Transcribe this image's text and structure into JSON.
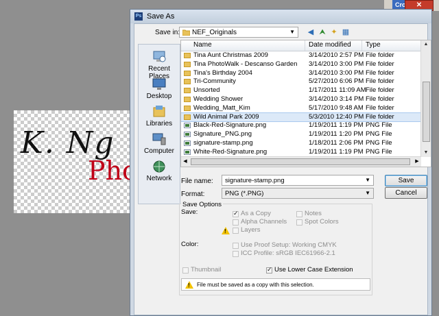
{
  "background": {
    "crop_label": "Crop",
    "close_label": "✕",
    "signature_text": "K. Ng",
    "photo_text": "Pho"
  },
  "dialog": {
    "title": "Save As",
    "save_in_label": "Save in:",
    "save_in_value": "NEF_Originals",
    "places": [
      {
        "label": "Recent Places",
        "icon": "recent-places-icon"
      },
      {
        "label": "Desktop",
        "icon": "desktop-icon"
      },
      {
        "label": "Libraries",
        "icon": "libraries-icon"
      },
      {
        "label": "Computer",
        "icon": "computer-icon"
      },
      {
        "label": "Network",
        "icon": "network-icon"
      }
    ],
    "columns": {
      "name": "Name",
      "date": "Date modified",
      "type": "Type"
    },
    "files": [
      {
        "name": "Tina Aunt Christmas 2009",
        "date": "3/14/2010 2:57 PM",
        "type": "File folder",
        "kind": "folder"
      },
      {
        "name": "Tina PhotoWalk - Descanso Garden",
        "date": "3/14/2010 3:00 PM",
        "type": "File folder",
        "kind": "folder"
      },
      {
        "name": "Tina's Birthday 2004",
        "date": "3/14/2010 3:00 PM",
        "type": "File folder",
        "kind": "folder"
      },
      {
        "name": "Tri-Community",
        "date": "5/27/2010 6:06 PM",
        "type": "File folder",
        "kind": "folder"
      },
      {
        "name": "Unsorted",
        "date": "1/17/2011 11:09 AM",
        "type": "File folder",
        "kind": "folder"
      },
      {
        "name": "Wedding Shower",
        "date": "3/14/2010 3:14 PM",
        "type": "File folder",
        "kind": "folder"
      },
      {
        "name": "Wedding_Matt_Kim",
        "date": "5/17/2010 9:48 AM",
        "type": "File folder",
        "kind": "folder"
      },
      {
        "name": "Wild Animal Park 2009",
        "date": "5/3/2010 12:40 PM",
        "type": "File folder",
        "kind": "folder"
      },
      {
        "name": "Black-Red-Signature.png",
        "date": "1/19/2011 1:19 PM",
        "type": "PNG File",
        "kind": "png"
      },
      {
        "name": "Signature_PNG.png",
        "date": "1/19/2011 1:20 PM",
        "type": "PNG File",
        "kind": "png"
      },
      {
        "name": "signature-stamp.png",
        "date": "1/18/2011 2:06 PM",
        "type": "PNG File",
        "kind": "png"
      },
      {
        "name": "White-Red-Signature.png",
        "date": "1/19/2011 1:19 PM",
        "type": "PNG File",
        "kind": "png"
      }
    ],
    "file_name_label": "File name:",
    "file_name_value": "signature-stamp.png",
    "format_label": "Format:",
    "format_value": "PNG (*.PNG)",
    "save_button": "Save",
    "cancel_button": "Cancel",
    "save_options_title": "Save Options",
    "save_label": "Save:",
    "as_a_copy": "As a Copy",
    "notes": "Notes",
    "alpha_channels": "Alpha Channels",
    "spot_colors": "Spot Colors",
    "layers": "Layers",
    "color_label": "Color:",
    "use_proof_setup": "Use Proof Setup:  Working CMYK",
    "icc_profile": "ICC Profile:  sRGB IEC61966-2.1",
    "thumbnail": "Thumbnail",
    "use_lower_case": "Use Lower Case Extension",
    "warning_message": "File must be saved as a copy with this selection."
  }
}
